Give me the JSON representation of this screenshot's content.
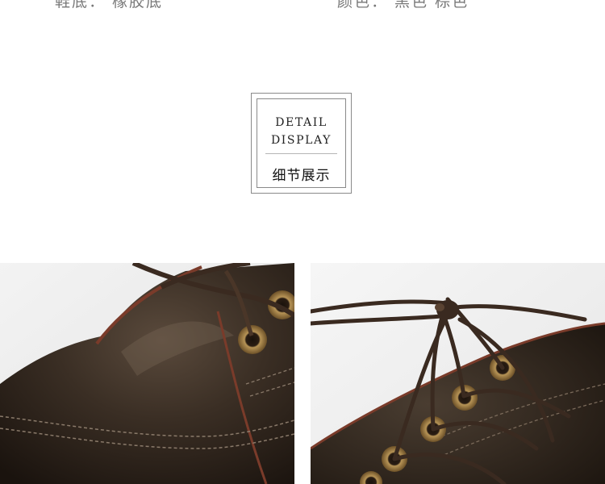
{
  "specs": {
    "sole": "鞋底：  橡胶底",
    "color": "颜色：  黑色  棕色"
  },
  "section_title": {
    "en_line1": "DETAIL",
    "en_line2": "DISPLAY",
    "cn": "细节展示"
  },
  "colors": {
    "leather": "#2e241b",
    "lace": "#3a2a20",
    "eyelet": "#9a7a43",
    "edge": "#7a3b2a"
  }
}
